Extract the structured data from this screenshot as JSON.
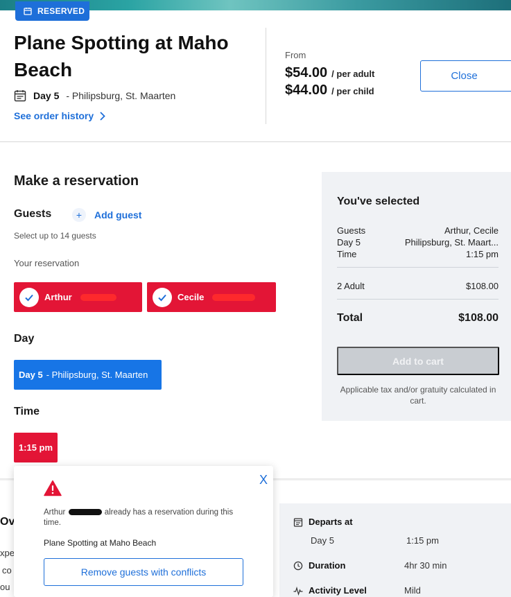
{
  "badge": {
    "label": "RESERVED"
  },
  "activity": {
    "title": "Plane Spotting at Maho Beach",
    "day": "Day 5",
    "location": "- Philipsburg, St. Maarten",
    "order_history_link": "See order history"
  },
  "pricing": {
    "from_label": "From",
    "adult_price": "$54.00",
    "adult_unit": "/ per adult",
    "child_price": "$44.00",
    "child_unit": "/ per child",
    "close_label": "Close"
  },
  "reservation": {
    "title": "Make a reservation",
    "guests_heading": "Guests",
    "add_guest_label": "Add guest",
    "guest_limit_hint": "Select up to 14 guests",
    "your_reservation_label": "Your reservation",
    "guests": [
      {
        "name": "Arthur"
      },
      {
        "name": "Cecile"
      }
    ],
    "day_heading": "Day",
    "day_option": {
      "day": "Day 5",
      "location": "- Philipsburg, St. Maarten"
    },
    "time_heading": "Time",
    "time_option": "1:15 pm"
  },
  "summary": {
    "title": "You've selected",
    "rows": [
      {
        "label": "Guests",
        "value": "Arthur, Cecile"
      },
      {
        "label": "Day 5",
        "value": "Philipsburg, St. Maart..."
      },
      {
        "label": "Time",
        "value": "1:15 pm"
      }
    ],
    "adult_count": "2 Adult",
    "adult_total": "$108.00",
    "total_label": "Total",
    "total_value": "$108.00",
    "add_to_cart": "Add to cart",
    "tax_note": "Applicable tax and/or gratuity calculated in cart."
  },
  "overview_fragments": {
    "heading": "Ove",
    "line1": "xpe",
    "line2": "co",
    "line3": "ou"
  },
  "details": {
    "departs_label": "Departs at",
    "departs_day": "Day 5",
    "departs_time": "1:15 pm",
    "duration_label": "Duration",
    "duration_value": "4hr 30 min",
    "activity_level_label": "Activity Level",
    "activity_level_value": "Mild"
  },
  "conflict_popup": {
    "close_glyph": "X",
    "guest_name": "Arthur",
    "message": "already has a reservation during this time.",
    "activity": "Plane Spotting at Maho Beach",
    "remove_button": "Remove guests with conflicts"
  },
  "colors": {
    "accent_blue": "#1e6fd9",
    "selected_red": "#e31536",
    "panel_gray": "#f0f2f5"
  }
}
